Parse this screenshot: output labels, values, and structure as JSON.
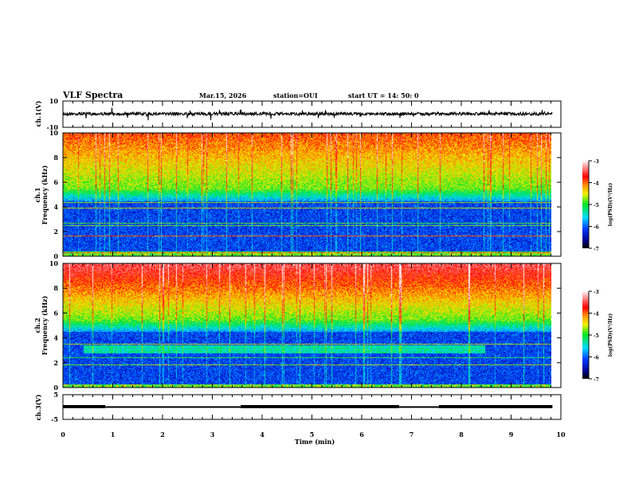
{
  "header": {
    "title": "VLF Spectra",
    "date": "Mar.15, 2026",
    "station": "station=OUI",
    "start": "start  UT =   14: 50: 0"
  },
  "chart_data": [
    {
      "type": "line",
      "panel": "ch1",
      "ylabel": "ch.1(V)",
      "ylim": [
        -10,
        10
      ],
      "yticks": [
        "10",
        "-10"
      ],
      "baseline": 0,
      "noise_amplitude": 1.5
    },
    {
      "type": "heatmap",
      "panel": "ch1-spectrogram",
      "ylabel": "ch.1",
      "ylabel2": "Frequency  (kHz)",
      "ylim": [
        0,
        10
      ],
      "yticks": [
        "0",
        "2",
        "4",
        "6",
        "8",
        "10"
      ],
      "colorbar": {
        "label": "log(PSD)(V²/Hz)",
        "range": [
          -7,
          -3
        ],
        "ticks": [
          "-3",
          "-4",
          "-5",
          "-6",
          "-7"
        ]
      }
    },
    {
      "type": "heatmap",
      "panel": "ch2-spectrogram",
      "ylabel": "ch.2",
      "ylabel2": "Frequency  (kHz)",
      "ylim": [
        0,
        10
      ],
      "yticks": [
        "0",
        "2",
        "4",
        "6",
        "8",
        "10"
      ],
      "colorbar": {
        "label": "log(PSD)(V²/Hz)",
        "range": [
          -7,
          -3
        ],
        "ticks": [
          "-3",
          "-4",
          "-5",
          "-6",
          "-7"
        ]
      }
    },
    {
      "type": "line",
      "panel": "ch3",
      "ylabel": "ch.3(V)",
      "ylim": [
        -5,
        5
      ],
      "yticks": [
        "5",
        "-5"
      ],
      "steps": [
        {
          "t0": 0,
          "t1": 0.85,
          "level": "high"
        },
        {
          "t0": 0.85,
          "t1": 3.57,
          "level": "low"
        },
        {
          "t0": 3.57,
          "t1": 6.75,
          "level": "high"
        },
        {
          "t0": 6.75,
          "t1": 7.55,
          "level": "low"
        },
        {
          "t0": 7.55,
          "t1": 9.83,
          "level": "high"
        }
      ]
    }
  ],
  "xaxis": {
    "label": "Time  (min)",
    "xlim": [
      0,
      10
    ],
    "ticks": [
      "0",
      "1",
      "2",
      "3",
      "4",
      "5",
      "6",
      "7",
      "8",
      "9",
      "10"
    ],
    "data_end": 9.83
  }
}
